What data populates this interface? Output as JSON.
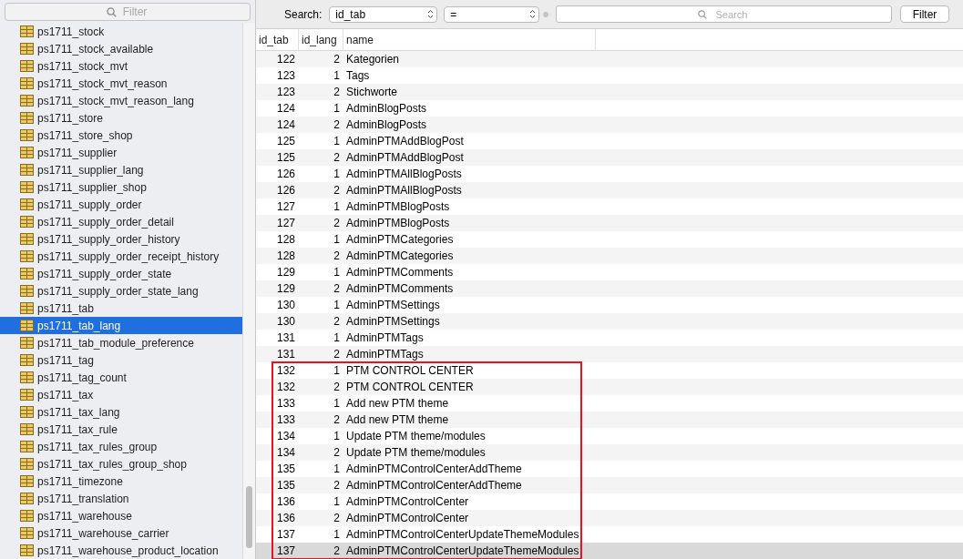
{
  "sidebar": {
    "filter": {
      "placeholder": "Filter"
    },
    "items": [
      {
        "label": "ps1711_stock",
        "selected": false
      },
      {
        "label": "ps1711_stock_available",
        "selected": false
      },
      {
        "label": "ps1711_stock_mvt",
        "selected": false
      },
      {
        "label": "ps1711_stock_mvt_reason",
        "selected": false
      },
      {
        "label": "ps1711_stock_mvt_reason_lang",
        "selected": false
      },
      {
        "label": "ps1711_store",
        "selected": false
      },
      {
        "label": "ps1711_store_shop",
        "selected": false
      },
      {
        "label": "ps1711_supplier",
        "selected": false
      },
      {
        "label": "ps1711_supplier_lang",
        "selected": false
      },
      {
        "label": "ps1711_supplier_shop",
        "selected": false
      },
      {
        "label": "ps1711_supply_order",
        "selected": false
      },
      {
        "label": "ps1711_supply_order_detail",
        "selected": false
      },
      {
        "label": "ps1711_supply_order_history",
        "selected": false
      },
      {
        "label": "ps1711_supply_order_receipt_history",
        "selected": false
      },
      {
        "label": "ps1711_supply_order_state",
        "selected": false
      },
      {
        "label": "ps1711_supply_order_state_lang",
        "selected": false
      },
      {
        "label": "ps1711_tab",
        "selected": false
      },
      {
        "label": "ps1711_tab_lang",
        "selected": true
      },
      {
        "label": "ps1711_tab_module_preference",
        "selected": false
      },
      {
        "label": "ps1711_tag",
        "selected": false
      },
      {
        "label": "ps1711_tag_count",
        "selected": false
      },
      {
        "label": "ps1711_tax",
        "selected": false
      },
      {
        "label": "ps1711_tax_lang",
        "selected": false
      },
      {
        "label": "ps1711_tax_rule",
        "selected": false
      },
      {
        "label": "ps1711_tax_rules_group",
        "selected": false
      },
      {
        "label": "ps1711_tax_rules_group_shop",
        "selected": false
      },
      {
        "label": "ps1711_timezone",
        "selected": false
      },
      {
        "label": "ps1711_translation",
        "selected": false
      },
      {
        "label": "ps1711_warehouse",
        "selected": false
      },
      {
        "label": "ps1711_warehouse_carrier",
        "selected": false
      },
      {
        "label": "ps1711_warehouse_product_location",
        "selected": false
      }
    ]
  },
  "search_bar": {
    "label": "Search:",
    "field": "id_tab",
    "operator": "=",
    "search": {
      "placeholder": "Search"
    },
    "button": "Filter"
  },
  "table": {
    "columns": [
      "id_tab",
      "id_lang",
      "name"
    ],
    "row_groups": [
      {
        "framed": false,
        "rows": [
          {
            "cells": [
              "122",
              "2",
              "Kategorien"
            ],
            "selected": false
          },
          {
            "cells": [
              "123",
              "1",
              "Tags"
            ],
            "selected": false
          },
          {
            "cells": [
              "123",
              "2",
              "Stichworte"
            ],
            "selected": false
          },
          {
            "cells": [
              "124",
              "1",
              "AdminBlogPosts"
            ],
            "selected": false
          },
          {
            "cells": [
              "124",
              "2",
              "AdminBlogPosts"
            ],
            "selected": false
          },
          {
            "cells": [
              "125",
              "1",
              "AdminPTMAddBlogPost"
            ],
            "selected": false
          },
          {
            "cells": [
              "125",
              "2",
              "AdminPTMAddBlogPost"
            ],
            "selected": false
          },
          {
            "cells": [
              "126",
              "1",
              "AdminPTMAllBlogPosts"
            ],
            "selected": false
          },
          {
            "cells": [
              "126",
              "2",
              "AdminPTMAllBlogPosts"
            ],
            "selected": false
          },
          {
            "cells": [
              "127",
              "1",
              "AdminPTMBlogPosts"
            ],
            "selected": false
          },
          {
            "cells": [
              "127",
              "2",
              "AdminPTMBlogPosts"
            ],
            "selected": false
          },
          {
            "cells": [
              "128",
              "1",
              "AdminPTMCategories"
            ],
            "selected": false
          },
          {
            "cells": [
              "128",
              "2",
              "AdminPTMCategories"
            ],
            "selected": false
          },
          {
            "cells": [
              "129",
              "1",
              "AdminPTMComments"
            ],
            "selected": false
          },
          {
            "cells": [
              "129",
              "2",
              "AdminPTMComments"
            ],
            "selected": false
          },
          {
            "cells": [
              "130",
              "1",
              "AdminPTMSettings"
            ],
            "selected": false
          },
          {
            "cells": [
              "130",
              "2",
              "AdminPTMSettings"
            ],
            "selected": false
          },
          {
            "cells": [
              "131",
              "1",
              "AdminPTMTags"
            ],
            "selected": false
          },
          {
            "cells": [
              "131",
              "2",
              "AdminPTMTags"
            ],
            "selected": false
          }
        ]
      },
      {
        "framed": true,
        "rows": [
          {
            "cells": [
              "132",
              "1",
              "PTM CONTROL CENTER"
            ],
            "selected": false
          },
          {
            "cells": [
              "132",
              "2",
              "PTM CONTROL CENTER"
            ],
            "selected": false
          },
          {
            "cells": [
              "133",
              "1",
              "Add new PTM theme"
            ],
            "selected": false
          },
          {
            "cells": [
              "133",
              "2",
              "Add new PTM theme"
            ],
            "selected": false
          },
          {
            "cells": [
              "134",
              "1",
              "Update PTM theme/modules"
            ],
            "selected": false
          },
          {
            "cells": [
              "134",
              "2",
              "Update PTM theme/modules"
            ],
            "selected": false
          },
          {
            "cells": [
              "135",
              "1",
              "AdminPTMControlCenterAddTheme"
            ],
            "selected": false
          },
          {
            "cells": [
              "135",
              "2",
              "AdminPTMControlCenterAddTheme"
            ],
            "selected": false
          },
          {
            "cells": [
              "136",
              "1",
              "AdminPTMControlCenter"
            ],
            "selected": false
          },
          {
            "cells": [
              "136",
              "2",
              "AdminPTMControlCenter"
            ],
            "selected": false
          },
          {
            "cells": [
              "137",
              "1",
              "AdminPTMControlCenterUpdateThemeModules"
            ],
            "selected": false
          },
          {
            "cells": [
              "137",
              "2",
              "AdminPTMControlCenterUpdateThemeModules"
            ],
            "selected": true
          }
        ]
      }
    ]
  }
}
